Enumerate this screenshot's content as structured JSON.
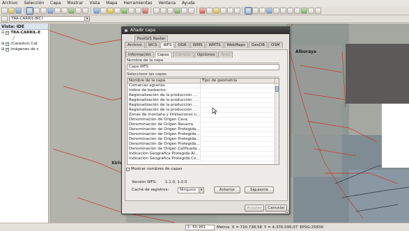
{
  "menubar": [
    "Archivo",
    "Selección",
    "Capa",
    "Mostrar",
    "Vista",
    "Mapa",
    "Herramientas",
    "Ventana",
    "Ayuda"
  ],
  "toolbar2": {
    "layer_combo": "TRA-CARRIL-BICI"
  },
  "toc": {
    "title": "Vista: IDE",
    "layers": [
      {
        "label": "TRA-CARRIL-E",
        "checked": true,
        "bold": true
      },
      {
        "label": "(Catastro) Cat",
        "checked": true,
        "bold": false
      },
      {
        "label": "Imágenes de s",
        "checked": true,
        "bold": false
      }
    ]
  },
  "map": {
    "labels": [
      "Alboraya",
      "Xirive"
    ]
  },
  "statusbar": {
    "scale": "1: 50.951",
    "units": "Metros",
    "x": "X = 720.738,58",
    "y": "Y = 4.376.595,07",
    "epsg": "EPSG:25830"
  },
  "dialog": {
    "title": "Añadir capa",
    "tabs_row1": [
      "PostGIS Raster"
    ],
    "tabs_row2": [
      "Archivo",
      "WCS",
      "WFS",
      "OGR",
      "WMS",
      "WMTS",
      "WebMaps",
      "GeoDB",
      "OSM"
    ],
    "active_tab": "WFS",
    "inner_tabs": [
      "Información",
      "Capas",
      "Campos",
      "Opciones",
      "Área"
    ],
    "active_inner_tab": "Capas",
    "layer_name_label": "Nombre de la capa",
    "layer_name_value": "Capa WFS",
    "select_layers_label": "Seleccione las capas",
    "table_headers": [
      "Nombre de la capa",
      "Tipo de geometría"
    ],
    "table_rows": [
      "Comarcas agrarias",
      "Índice de barbecho",
      "Regionalización de la producción. ...",
      "Regionalización de la producción. ...",
      "Regionalización de la producción. ...",
      "Regionalización de la producción. ...",
      "Zonas de montaña y limitaciones n...",
      "Denominación de Origen Cava",
      "Denominación de Origen Navarra",
      "Denominación de Origen Protegida...",
      "Denominación de Origen Protegida...",
      "Denominación de Origen Protegida...",
      "Denominación de Origen Protegida...",
      "Denominación de Origen Calificada...",
      "Indicación Geográfica Protegida Al...",
      "Indicación Geográfica Protegida Co..."
    ],
    "show_names_label": "Mostrar nombres de capas",
    "wfs_version_label": "Versión WFS:",
    "wfs_version_value": "1.1.0, 1.0.0",
    "cache_label": "Caché de registros:",
    "cache_value": "Ninguno",
    "prev_button": "Anterior",
    "next_button": "Siguiente",
    "accept_button": "Aceptar",
    "cancel_button": "Cancelar"
  }
}
